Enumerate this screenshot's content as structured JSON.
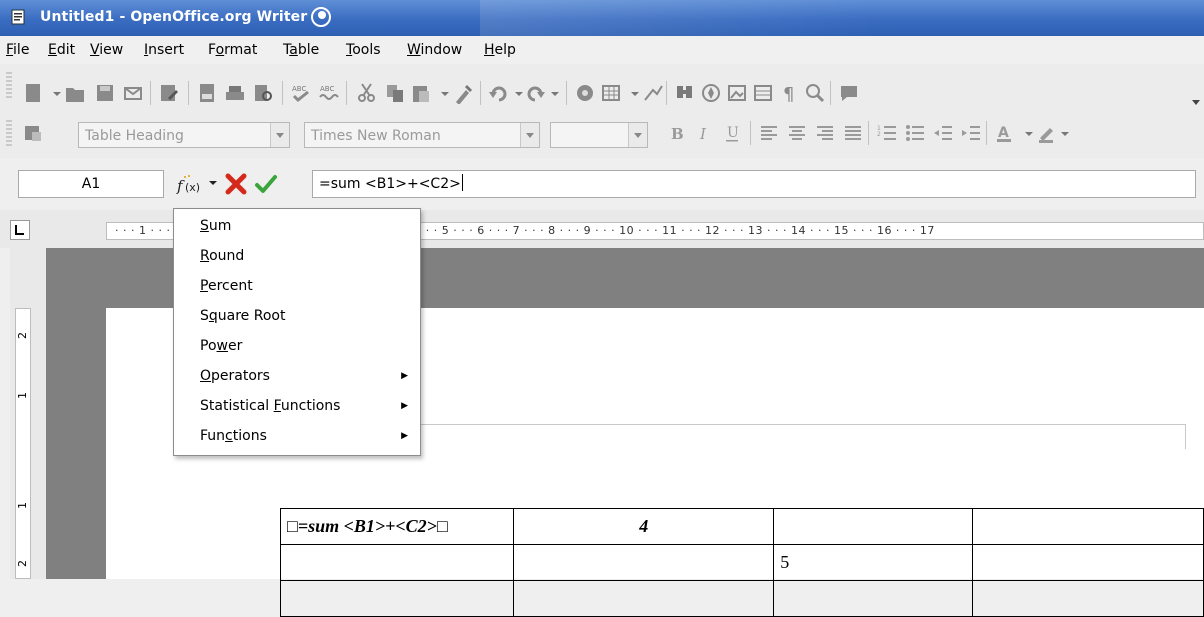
{
  "window": {
    "title": "Untitled1 - OpenOffice.org Writer"
  },
  "menubar": [
    {
      "label": "File",
      "ul": "F"
    },
    {
      "label": "Edit",
      "ul": "E"
    },
    {
      "label": "View",
      "ul": "V"
    },
    {
      "label": "Insert",
      "ul": "I"
    },
    {
      "label": "Format",
      "ul": "o"
    },
    {
      "label": "Table",
      "ul": "a"
    },
    {
      "label": "Tools",
      "ul": "T"
    },
    {
      "label": "Window",
      "ul": "W"
    },
    {
      "label": "Help",
      "ul": "H"
    }
  ],
  "format_bar": {
    "paragraph_style": "Table Heading",
    "font_name": "Times New Roman",
    "font_size": ""
  },
  "formula_bar": {
    "cell_ref": "A1",
    "formula": "=sum <B1>+<C2>"
  },
  "ruler": {
    "labels": "· · · 1 · · · · · · · · · · · · · · · · · · · · · · · · · · · · · · · · · 4 · · 5 · · · 6 · · · 7 · · · 8 · · · 9 · · · 10 · · · 11 · · · 12 · · · 13 · · · 14 · · · 15 · · · 16 · · · 17",
    "vertical_labels": [
      "2",
      "1",
      "1",
      "2"
    ]
  },
  "formula_menu": {
    "items": [
      {
        "label": "Sum",
        "ul_index": 0,
        "submenu": false
      },
      {
        "label": "Round",
        "ul_index": 0,
        "submenu": false
      },
      {
        "label": "Percent",
        "ul_index": 0,
        "submenu": false
      },
      {
        "label": "Square Root",
        "ul_index": 1,
        "submenu": false
      },
      {
        "label": "Power",
        "ul_index": 2,
        "submenu": false
      },
      {
        "label": "Operators",
        "ul_index": 0,
        "submenu": true
      },
      {
        "label": "Statistical Functions",
        "ul_index": 12,
        "submenu": true
      },
      {
        "label": "Functions",
        "ul_index": 3,
        "submenu": true
      }
    ]
  },
  "document_table": {
    "rows": [
      [
        "□=sum <B1>+<C2>□",
        "4",
        "",
        ""
      ],
      [
        "",
        "",
        "5",
        ""
      ],
      [
        "",
        "",
        "",
        ""
      ]
    ]
  },
  "colors": {
    "titlebar": "#3a6cc1",
    "cancel_icon": "#d42a1b",
    "apply_icon": "#3aa63a"
  }
}
